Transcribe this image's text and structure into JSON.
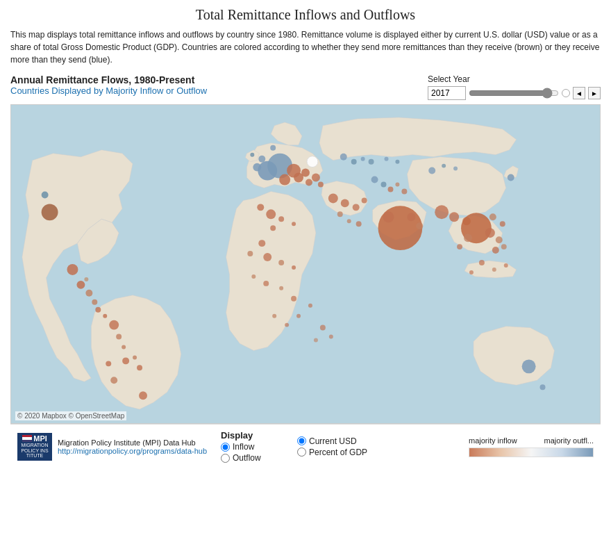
{
  "title": "Total Remittance Inflows and Outflows",
  "description": "This map displays total remittance inflows and outflows by country since 1980. Remittance volume is displayed either by current U.S. dollar (USD) value or as a share of total Gross Domestic Product (GDP). Countries are colored according to whether they send more remittances than they receive (brown) or they receive more than they send (blue).",
  "map_label": {
    "main": "Annual Remittance Flows, 1980-Present",
    "sub": "Countries Displayed by Majority Inflow or Outflow"
  },
  "year_selector": {
    "label": "Select Year",
    "value": "2017"
  },
  "display": {
    "title": "Display",
    "inflow_label": "Inflow",
    "outflow_label": "Outflow"
  },
  "measure": {
    "usd_label": "Current USD",
    "gdp_label": "Percent of GDP"
  },
  "legend": {
    "majority_inflow": "majority inflow",
    "majority_outflow": "majority outfl..."
  },
  "credit": "© 2020 Mapbox © OpenStreetMap",
  "mpi": {
    "name": "Migration Policy Institute (MPI) Data Hub",
    "link": "http://migrationpolicy.org/programs/data-hub",
    "abbr": "MPI",
    "bottom": "MIGRATION POLICY INSTITUTE"
  },
  "nav": {
    "prev": "◄",
    "next": "►"
  }
}
